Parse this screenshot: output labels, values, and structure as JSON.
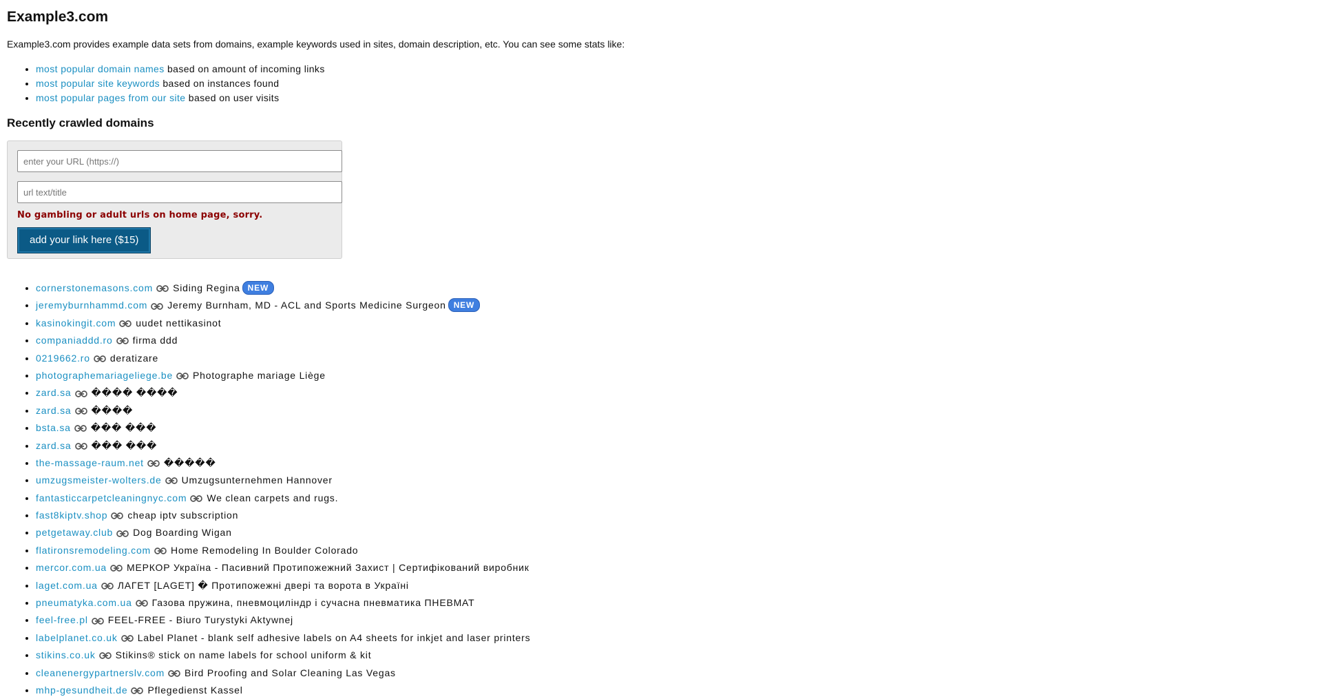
{
  "header": {
    "title": "Example3.com",
    "intro": "Example3.com provides example data sets from domains, example keywords used in sites, domain description, etc. You can see some stats like:"
  },
  "stats": [
    {
      "link": "most popular domain names",
      "text": "based on amount of incoming links"
    },
    {
      "link": "most popular site keywords",
      "text": "based on instances found"
    },
    {
      "link": "most popular pages from our site",
      "text": "based on user visits"
    }
  ],
  "recent": {
    "heading": "Recently crawled domains"
  },
  "form": {
    "url_placeholder": "enter your URL (https://)",
    "title_placeholder": "url text/title",
    "warning": "No gambling or adult urls on home page, sorry.",
    "button_label": "add your link here ($15)"
  },
  "badge_label": "NEW",
  "colors": {
    "link": "#1a8fc2",
    "warning": "#8b0000",
    "button": "#0b5a86",
    "badge": "#3f7fe0"
  },
  "domains": [
    {
      "domain": "cornerstonemasons.com",
      "desc": "Siding Regina",
      "is_new": true
    },
    {
      "domain": "jeremyburnhammd.com",
      "desc": "Jeremy Burnham, MD - ACL and Sports Medicine Surgeon",
      "is_new": true
    },
    {
      "domain": "kasinokingit.com",
      "desc": "uudet nettikasinot",
      "is_new": false
    },
    {
      "domain": "companiaddd.ro",
      "desc": "firma ddd",
      "is_new": false
    },
    {
      "domain": "0219662.ro",
      "desc": "deratizare",
      "is_new": false
    },
    {
      "domain": "photographemariageliege.be",
      "desc": "Photographe mariage Liège",
      "is_new": false
    },
    {
      "domain": "zard.sa",
      "desc": "���� ����",
      "is_new": false
    },
    {
      "domain": "zard.sa",
      "desc": "����",
      "is_new": false
    },
    {
      "domain": "bsta.sa",
      "desc": "��� ���",
      "is_new": false
    },
    {
      "domain": "zard.sa",
      "desc": "��� ���",
      "is_new": false
    },
    {
      "domain": "the-massage-raum.net",
      "desc": "�����",
      "is_new": false
    },
    {
      "domain": "umzugsmeister-wolters.de",
      "desc": "Umzugsunternehmen Hannover",
      "is_new": false
    },
    {
      "domain": "fantasticcarpetcleaningnyc.com",
      "desc": "We clean carpets and rugs.",
      "is_new": false
    },
    {
      "domain": "fast8kiptv.shop",
      "desc": "cheap iptv subscription",
      "is_new": false
    },
    {
      "domain": "petgetaway.club",
      "desc": "Dog Boarding Wigan",
      "is_new": false
    },
    {
      "domain": "flatironsremodeling.com",
      "desc": "Home Remodeling In Boulder Colorado",
      "is_new": false
    },
    {
      "domain": "mercor.com.ua",
      "desc": "МЕРКОР Україна - Пасивний Протипожежний Захист | Сертифікований виробник",
      "is_new": false
    },
    {
      "domain": "laget.com.ua",
      "desc": "ЛАГЕТ [LAGET] � Протипожежні двері та ворота в Україні",
      "is_new": false
    },
    {
      "domain": "pneumatyka.com.ua",
      "desc": "Газова пружина, пневмоциліндр і сучасна пневматика ПНЕВМАТ",
      "is_new": false
    },
    {
      "domain": "feel-free.pl",
      "desc": "FEEL-FREE - Biuro Turystyki Aktywnej",
      "is_new": false
    },
    {
      "domain": "labelplanet.co.uk",
      "desc": "Label Planet - blank self adhesive labels on A4 sheets for inkjet and laser printers",
      "is_new": false
    },
    {
      "domain": "stikins.co.uk",
      "desc": "Stikins® stick on name labels for school uniform & kit",
      "is_new": false
    },
    {
      "domain": "cleanenergypartnerslv.com",
      "desc": "Bird Proofing and Solar Cleaning Las Vegas",
      "is_new": false
    },
    {
      "domain": "mhp-gesundheit.de",
      "desc": "Pflegedienst Kassel",
      "is_new": false
    }
  ]
}
